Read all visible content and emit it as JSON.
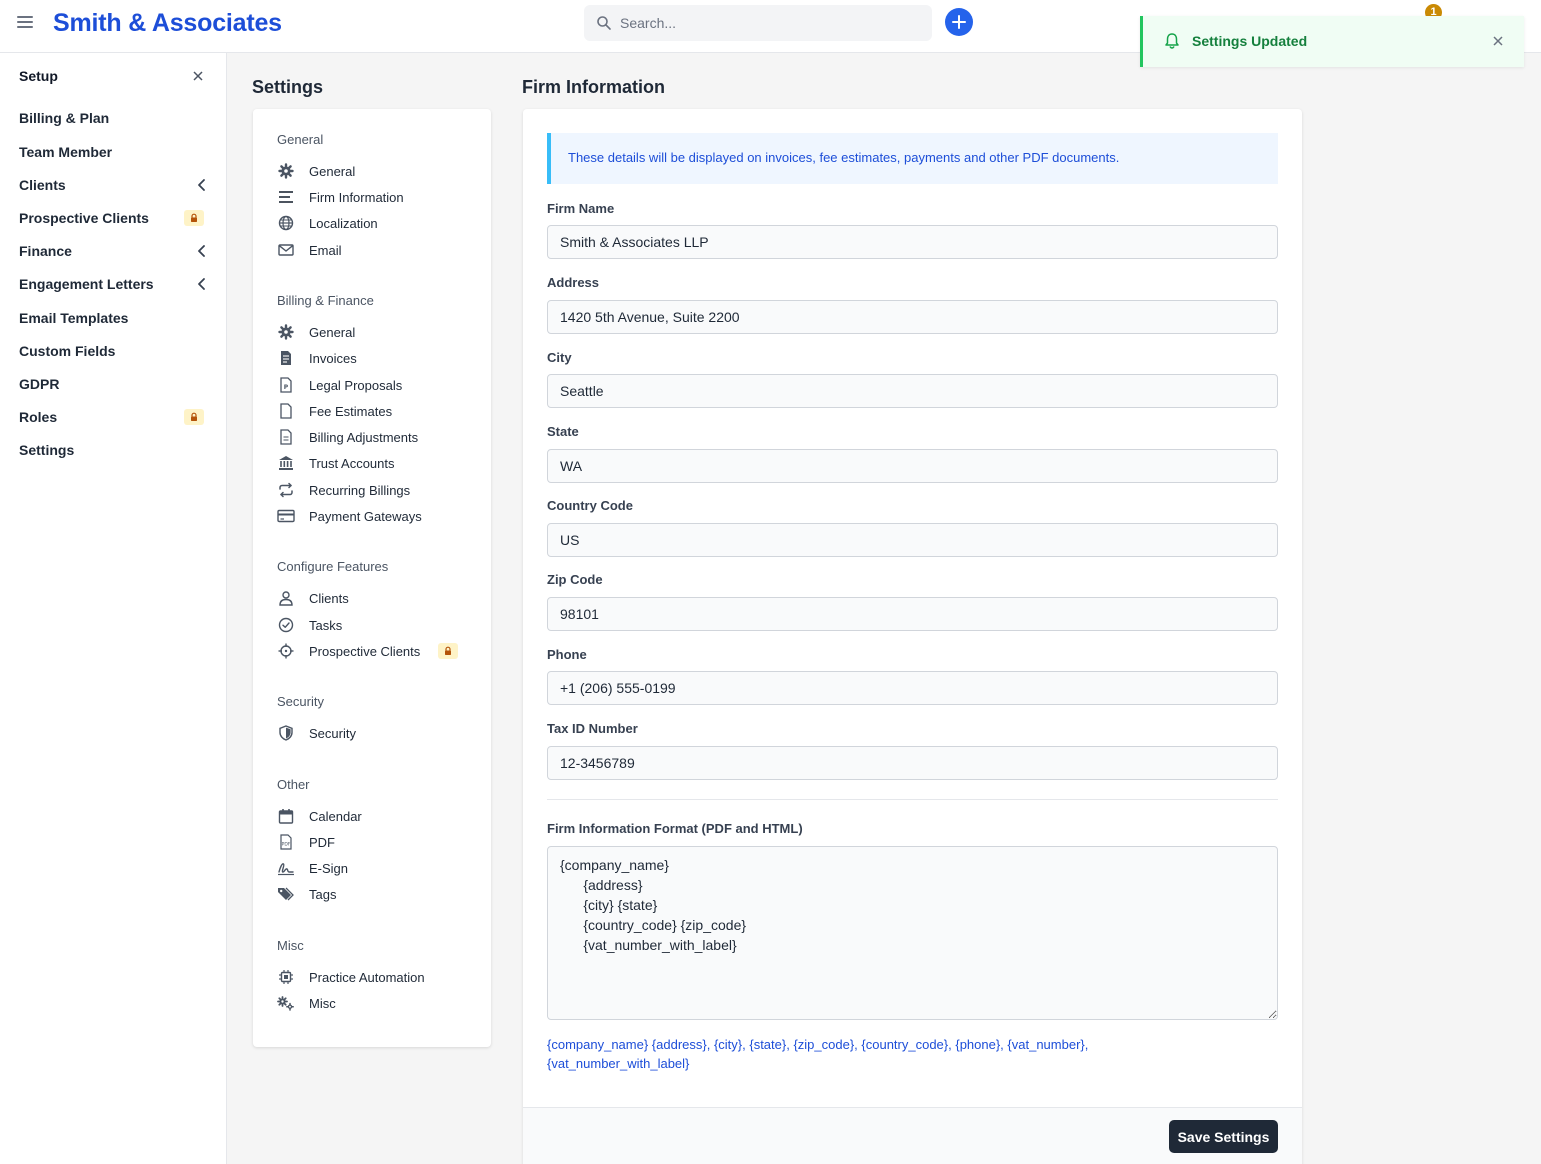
{
  "header": {
    "brand": "Smith & Associates",
    "search_placeholder": "Search...",
    "notification_count": "1"
  },
  "toast": {
    "message": "Settings Updated"
  },
  "sidebar": {
    "title": "Setup",
    "items": [
      {
        "label": "Billing & Plan"
      },
      {
        "label": "Team Member"
      },
      {
        "label": "Clients"
      },
      {
        "label": "Prospective Clients"
      },
      {
        "label": "Finance"
      },
      {
        "label": "Engagement Letters"
      },
      {
        "label": "Email Templates"
      },
      {
        "label": "Custom Fields"
      },
      {
        "label": "GDPR"
      },
      {
        "label": "Roles"
      },
      {
        "label": "Settings"
      }
    ]
  },
  "settings_nav": {
    "title": "Settings",
    "groups": [
      {
        "label": "General",
        "items": [
          {
            "label": "General",
            "icon": "gear-icon"
          },
          {
            "label": "Firm Information",
            "icon": "lines-icon"
          },
          {
            "label": "Localization",
            "icon": "globe-icon"
          },
          {
            "label": "Email",
            "icon": "envelope-icon"
          }
        ]
      },
      {
        "label": "Billing & Finance",
        "items": [
          {
            "label": "General",
            "icon": "gear-icon"
          },
          {
            "label": "Invoices",
            "icon": "invoice-icon"
          },
          {
            "label": "Legal Proposals",
            "icon": "proposal-icon"
          },
          {
            "label": "Fee Estimates",
            "icon": "file-icon"
          },
          {
            "label": "Billing Adjustments",
            "icon": "file-lines-icon"
          },
          {
            "label": "Trust Accounts",
            "icon": "bank-icon"
          },
          {
            "label": "Recurring Billings",
            "icon": "repeat-icon"
          },
          {
            "label": "Payment Gateways",
            "icon": "credit-card-icon"
          }
        ]
      },
      {
        "label": "Configure Features",
        "items": [
          {
            "label": "Clients",
            "icon": "user-icon"
          },
          {
            "label": "Tasks",
            "icon": "check-circle-icon"
          },
          {
            "label": "Prospective Clients",
            "icon": "crosshair-icon"
          }
        ]
      },
      {
        "label": "Security",
        "items": [
          {
            "label": "Security",
            "icon": "shield-icon"
          }
        ]
      },
      {
        "label": "Other",
        "items": [
          {
            "label": "Calendar",
            "icon": "calendar-icon"
          },
          {
            "label": "PDF",
            "icon": "pdf-icon"
          },
          {
            "label": "E-Sign",
            "icon": "signature-icon"
          },
          {
            "label": "Tags",
            "icon": "tags-icon"
          }
        ]
      },
      {
        "label": "Misc",
        "items": [
          {
            "label": "Practice Automation",
            "icon": "chip-icon"
          },
          {
            "label": "Misc",
            "icon": "gears-icon"
          }
        ]
      }
    ]
  },
  "form": {
    "title": "Firm Information",
    "info": "These details will be displayed on invoices, fee estimates, payments and other PDF documents.",
    "fields": [
      {
        "label": "Firm Name",
        "value": "Smith & Associates LLP"
      },
      {
        "label": "Address",
        "value": "1420 5th Avenue, Suite 2200"
      },
      {
        "label": "City",
        "value": "Seattle"
      },
      {
        "label": "State",
        "value": "WA"
      },
      {
        "label": "Country Code",
        "value": "US"
      },
      {
        "label": "Zip Code",
        "value": "98101"
      },
      {
        "label": "Phone",
        "value": "+1 (206) 555-0199"
      },
      {
        "label": "Tax ID Number",
        "value": "12-3456789"
      }
    ],
    "format_label": "Firm Information Format (PDF and HTML)",
    "format_value": "{company_name}\n      {address}\n      {city} {state}\n      {country_code} {zip_code}\n      {vat_number_with_label}",
    "placeholders_line1": "{company_name} {address}, {city}, {state}, {zip_code}, {country_code}, {phone}, {vat_number},",
    "placeholders_line2": "{vat_number_with_label}",
    "save_label": "Save Settings"
  },
  "colors": {
    "brand": "#1d4ed8",
    "accent": "#2563eb",
    "success": "#22c55e",
    "lock_bg": "#fef3c7",
    "lock_icon": "#b45309"
  }
}
